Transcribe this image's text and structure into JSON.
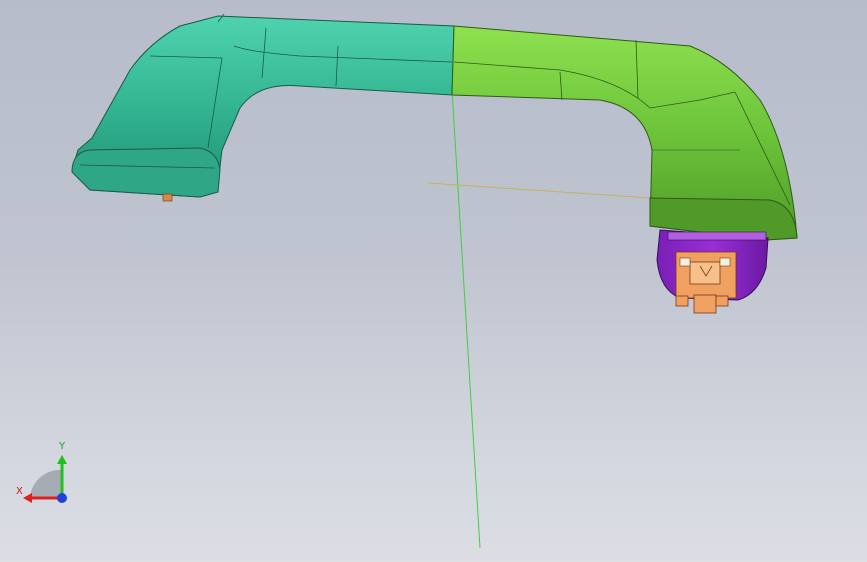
{
  "viewport": {
    "background_top": "#b7bccb",
    "background_bottom": "#dcdee4"
  },
  "model": {
    "part_left_color": "#35b895",
    "part_right_color": "#6cc43a",
    "clip_color": "#8a22c8",
    "insert_color": "#f0a060",
    "datum_line_color": "#3fd03f",
    "datum_line2_color": "#c8b060"
  },
  "triad": {
    "x_label": "X",
    "y_label": "Y",
    "x_color": "#e02020",
    "y_color": "#20c020",
    "z_color": "#2040e0"
  }
}
